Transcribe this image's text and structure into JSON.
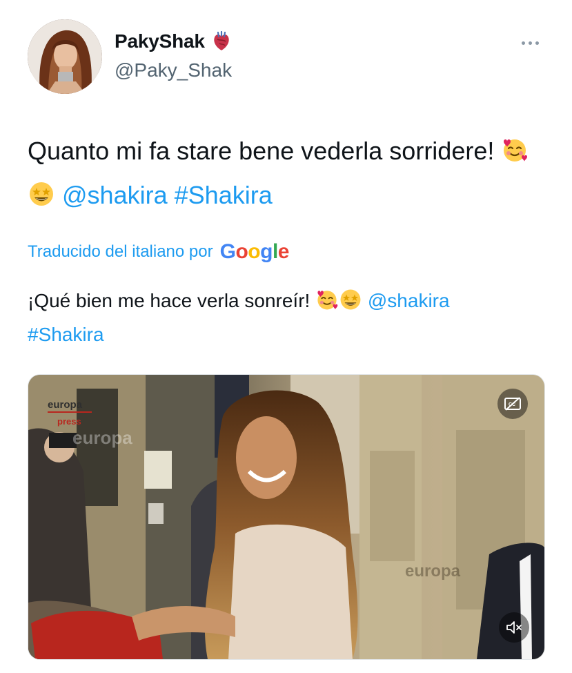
{
  "user": {
    "display_name": "PakyShak",
    "handle": "@Paky_Shak",
    "verified_icon": "anatomical-heart-icon"
  },
  "tweet": {
    "text_before": "Quanto mi fa stare bene vederla sorridere! ",
    "emojis": [
      "smiling-face-with-hearts",
      "star-struck"
    ],
    "mention": "@shakira",
    "hashtag": "#Shakira"
  },
  "translation": {
    "label": "Traducido del italiano por",
    "provider": "Google",
    "text_before": "¡Qué bien me hace verla sonreír! ",
    "mention": "@shakira",
    "hashtag": "#Shakira"
  },
  "media": {
    "watermark_top": "europa",
    "watermark_sub": "press",
    "watermark_center": "europa",
    "watermark_right": "europa",
    "cc_icon": "closed-captions-off-icon",
    "mute_icon": "speaker-muted-icon"
  },
  "colors": {
    "link": "#1d9bf0",
    "secondary_text": "#536471",
    "primary_text": "#0f1419"
  }
}
